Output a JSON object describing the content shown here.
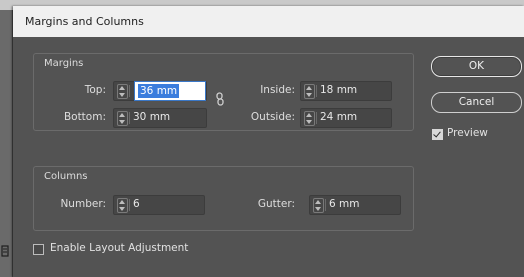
{
  "dialog": {
    "title": "Margins and Columns"
  },
  "margins": {
    "group_label": "Margins",
    "top_label": "Top:",
    "top_value": "36 mm",
    "bottom_label": "Bottom:",
    "bottom_value": "30 mm",
    "inside_label": "Inside:",
    "inside_value": "18 mm",
    "outside_label": "Outside:",
    "outside_value": "24 mm",
    "link_icon": "chain-link-icon"
  },
  "columns": {
    "group_label": "Columns",
    "number_label": "Number:",
    "number_value": "6",
    "gutter_label": "Gutter:",
    "gutter_value": "6 mm"
  },
  "buttons": {
    "ok_label": "OK",
    "cancel_label": "Cancel"
  },
  "preview": {
    "label": "Preview",
    "checked": true
  },
  "layout_adjustment": {
    "label": "Enable Layout Adjustment",
    "checked": false
  },
  "colors": {
    "dialog_bg": "#535353",
    "titlebar_bg": "#f0f0f0",
    "selection": "#3b7ddd"
  }
}
